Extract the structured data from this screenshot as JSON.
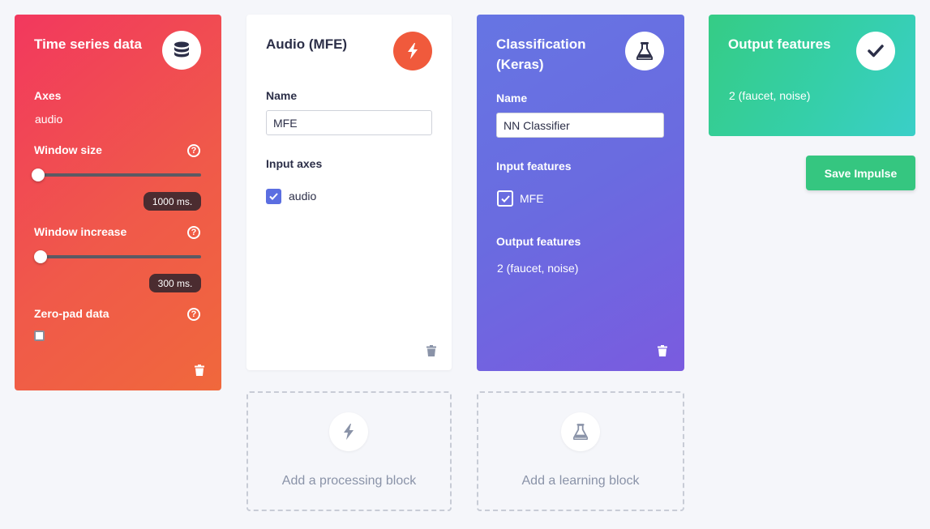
{
  "time_series": {
    "title": "Time series data",
    "icon": "database-icon",
    "axes_label": "Axes",
    "axes_value": "audio",
    "window_size_label": "Window size",
    "window_size_value": "1000 ms.",
    "window_increase_label": "Window increase",
    "window_increase_value": "300 ms.",
    "zero_pad_label": "Zero-pad data",
    "zero_pad_checked": false,
    "help_glyph": "?"
  },
  "audio_block": {
    "title": "Audio (MFE)",
    "icon": "lightning-icon",
    "name_label": "Name",
    "name_value": "MFE",
    "input_axes_label": "Input axes",
    "input_axes": [
      {
        "label": "audio",
        "checked": true
      }
    ]
  },
  "classification_block": {
    "title_line1": "Classification",
    "title_line2": "(Keras)",
    "icon": "flask-icon",
    "name_label": "Name",
    "name_value": "NN Classifier",
    "input_features_label": "Input features",
    "input_features": [
      {
        "label": "MFE",
        "checked": true
      }
    ],
    "output_features_label": "Output features",
    "output_features_value": "2 (faucet, noise)"
  },
  "output_block": {
    "title": "Output features",
    "icon": "checkmark-icon",
    "value": "2 (faucet, noise)"
  },
  "actions": {
    "save_label": "Save Impulse",
    "add_processing_label": "Add a processing block",
    "add_learning_label": "Add a learning block"
  },
  "colors": {
    "time_series_gradient": [
      "#f2385e",
      "#f0683c"
    ],
    "audio_icon": "#f05a3c",
    "classification_gradient": [
      "#6675e3",
      "#7a5bdf"
    ],
    "output_gradient": [
      "#35cc85",
      "#3acfc8"
    ],
    "save_button": "#35c680",
    "checkbox_accent": "#5b6ee1"
  }
}
